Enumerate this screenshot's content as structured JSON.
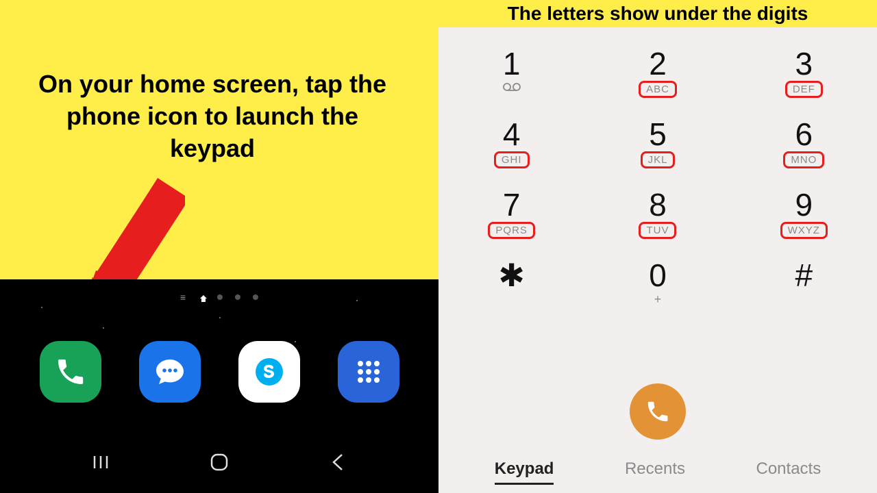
{
  "annotations": {
    "left_caption": "On your home screen, tap the phone icon to launch the keypad",
    "right_caption": "The letters show under the digits"
  },
  "home_screen": {
    "dock": [
      {
        "name": "phone",
        "color": "#17a257"
      },
      {
        "name": "messages",
        "color": "#1a73e8"
      },
      {
        "name": "skype",
        "color": "#ffffff"
      },
      {
        "name": "apps",
        "color": "#2964d9"
      }
    ],
    "nav": {
      "recents": "|||",
      "home": "◯",
      "back": "‹"
    }
  },
  "dialer": {
    "keys": [
      {
        "digit": "1",
        "letters": "",
        "voicemail": true,
        "boxed": false
      },
      {
        "digit": "2",
        "letters": "ABC",
        "boxed": true
      },
      {
        "digit": "3",
        "letters": "DEF",
        "boxed": true
      },
      {
        "digit": "4",
        "letters": "GHI",
        "boxed": true
      },
      {
        "digit": "5",
        "letters": "JKL",
        "boxed": true
      },
      {
        "digit": "6",
        "letters": "MNO",
        "boxed": true
      },
      {
        "digit": "7",
        "letters": "PQRS",
        "boxed": true
      },
      {
        "digit": "8",
        "letters": "TUV",
        "boxed": true
      },
      {
        "digit": "9",
        "letters": "WXYZ",
        "boxed": true
      },
      {
        "digit": "✱",
        "letters": "",
        "boxed": false
      },
      {
        "digit": "0",
        "letters": "+",
        "plus": true,
        "boxed": false
      },
      {
        "digit": "#",
        "letters": "",
        "boxed": false
      }
    ],
    "tabs": [
      {
        "label": "Keypad",
        "active": true
      },
      {
        "label": "Recents",
        "active": false
      },
      {
        "label": "Contacts",
        "active": false
      }
    ],
    "call_button": "call-icon"
  },
  "colors": {
    "annotation_bg": "#ffed4a",
    "arrow": "#e61e1e",
    "highlight_box": "#e61e1e",
    "call_button": "#e49236"
  }
}
